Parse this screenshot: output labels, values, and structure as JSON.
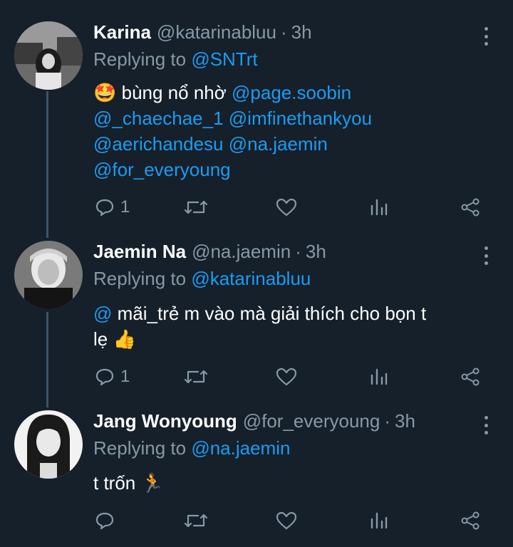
{
  "tweets": [
    {
      "name": "Karina",
      "handle": "@katarinabluu",
      "separator": "·",
      "time": "3h",
      "replying_prefix": "Replying to",
      "replying_to": "@SNTrt",
      "emoji": "🤩",
      "text_lines": [
        "bùng nổ nhờ"
      ],
      "mentions": [
        "@page.soobin",
        "@_chaechae_1",
        "@imfinethankyou",
        "@aerichandesu",
        "@na.jaemin",
        "@for_everyoung"
      ],
      "reply_count": "1"
    },
    {
      "name": "Jaemin Na",
      "handle": "@na.jaemin",
      "separator": "·",
      "time": "3h",
      "replying_prefix": "Replying to",
      "replying_to": "@katarinabluu",
      "mention_start": "@",
      "text": "mãi_trẻ m vào mà giải thích cho bọn t",
      "text2": "lẹ",
      "emoji": "👍",
      "reply_count": "1"
    },
    {
      "name": "Jang Wonyoung",
      "handle": "@for_everyoung",
      "separator": "·",
      "time": "3h",
      "replying_prefix": "Replying to",
      "replying_to": "@na.jaemin",
      "text": "t trốn",
      "emoji": "🏃",
      "reply_count": ""
    }
  ],
  "icons": {
    "reply": "reply-icon",
    "retweet": "retweet-icon",
    "like": "heart-icon",
    "views": "analytics-icon",
    "share": "share-icon",
    "more": "more-vertical-icon"
  },
  "colors": {
    "background": "#15202b",
    "accent": "#1d9bf0",
    "muted": "#8899a6",
    "thread_line": "#3d5466"
  }
}
